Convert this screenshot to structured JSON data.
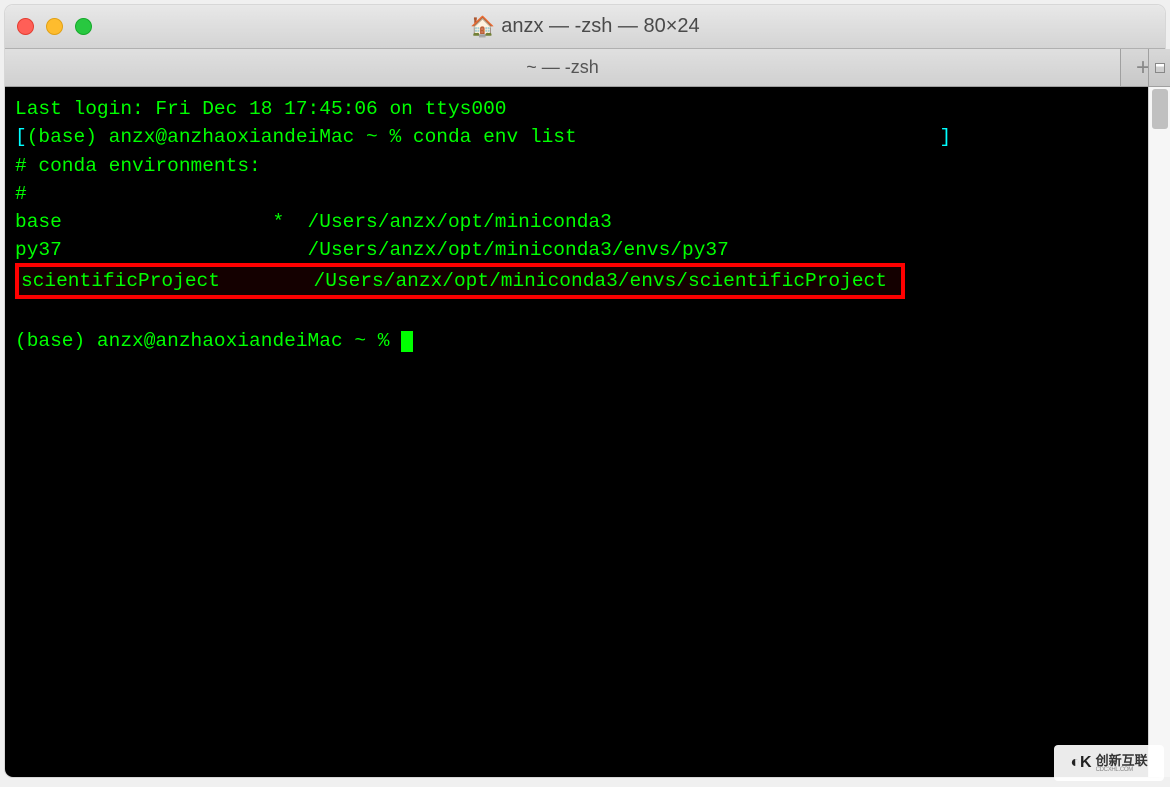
{
  "window": {
    "title": "anzx — -zsh — 80×24"
  },
  "tabs": {
    "active_label": "~ — -zsh"
  },
  "terminal": {
    "last_login": "Last login: Fri Dec 18 17:45:06 on ttys000",
    "prompt1_open": "[",
    "prompt1_text": "(base) anzx@anzhaoxiandeiMac ~ % conda env list",
    "prompt1_close": "]",
    "comment1": "# conda environments:",
    "comment2": "#",
    "env_base": "base                  *  /Users/anzx/opt/miniconda3",
    "env_py37": "py37                     /Users/anzx/opt/miniconda3/envs/py37",
    "env_sci": "scientificProject        /Users/anzx/opt/miniconda3/envs/scientificProject ",
    "blank": " ",
    "prompt2": "(base) anzx@anzhaoxiandeiMac ~ % "
  },
  "watermark": {
    "main": "创新互联",
    "sub": "CDCXHL.COM"
  }
}
